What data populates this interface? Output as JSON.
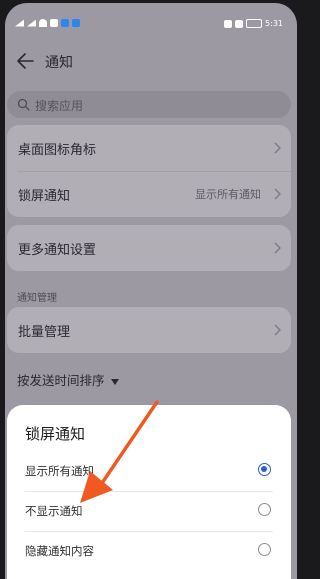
{
  "status_bar": {
    "time": "5:31"
  },
  "header": {
    "title": "通知"
  },
  "search": {
    "placeholder": "搜索应用"
  },
  "settings": {
    "badge_row": {
      "label": "桌面图标角标"
    },
    "lock_screen_row": {
      "label": "锁屏通知",
      "value": "显示所有通知"
    },
    "more_settings_row": {
      "label": "更多通知设置"
    },
    "section_label": "通知管理",
    "batch_row": {
      "label": "批量管理"
    },
    "sort_label": "按发送时间排序"
  },
  "sheet": {
    "title": "锁屏通知",
    "options": [
      {
        "label": "显示所有通知",
        "selected": true
      },
      {
        "label": "不显示通知",
        "selected": false
      },
      {
        "label": "隐藏通知内容",
        "selected": false
      }
    ]
  },
  "colors": {
    "accent": "#2b5ddc",
    "annotation_arrow": "#f05a22"
  }
}
